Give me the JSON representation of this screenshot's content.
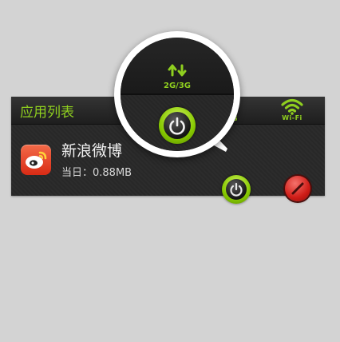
{
  "app_list": {
    "title": "应用列表",
    "columns": {
      "mobile_label": "3G",
      "wifi_label": "Wi-Fi"
    },
    "apps": [
      {
        "name": "新浪微博",
        "usage": "当日：0.88MB",
        "mobile_toggle": "on",
        "wifi_toggle": "blocked"
      }
    ]
  },
  "magnifier": {
    "network_label": "2G/3G"
  },
  "colors": {
    "accent": "#8fcf1f",
    "block": "#cf1d17",
    "weibo": "#e8432b"
  }
}
